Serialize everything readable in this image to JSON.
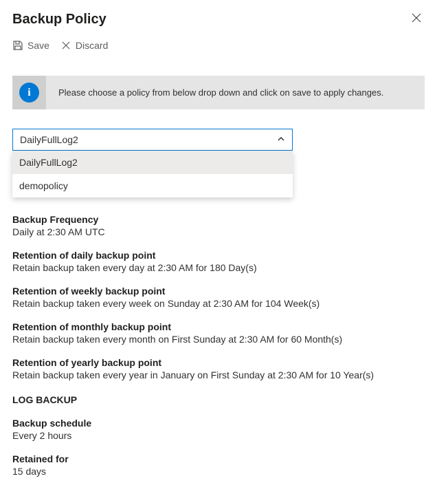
{
  "header": {
    "title": "Backup Policy"
  },
  "toolbar": {
    "save_label": "Save",
    "discard_label": "Discard"
  },
  "banner": {
    "text": "Please choose a policy from below drop down and click on save to apply changes."
  },
  "dropdown": {
    "selected": "DailyFullLog2",
    "options": [
      "DailyFullLog2",
      "demopolicy"
    ]
  },
  "details": {
    "frequency": {
      "title": "Backup Frequency",
      "text": "Daily at 2:30 AM UTC"
    },
    "daily": {
      "title": "Retention of daily backup point",
      "text": "Retain backup taken every day at 2:30 AM for 180 Day(s)"
    },
    "weekly": {
      "title": "Retention of weekly backup point",
      "text": "Retain backup taken every week on Sunday at 2:30 AM for 104 Week(s)"
    },
    "monthly": {
      "title": "Retention of monthly backup point",
      "text": "Retain backup taken every month on First Sunday at 2:30 AM for 60 Month(s)"
    },
    "yearly": {
      "title": "Retention of yearly backup point",
      "text": "Retain backup taken every year in January on First Sunday at 2:30 AM for 10 Year(s)"
    },
    "log_header": "LOG BACKUP",
    "schedule": {
      "title": "Backup schedule",
      "text": "Every 2 hours"
    },
    "retained": {
      "title": "Retained for",
      "text": "15 days"
    }
  }
}
